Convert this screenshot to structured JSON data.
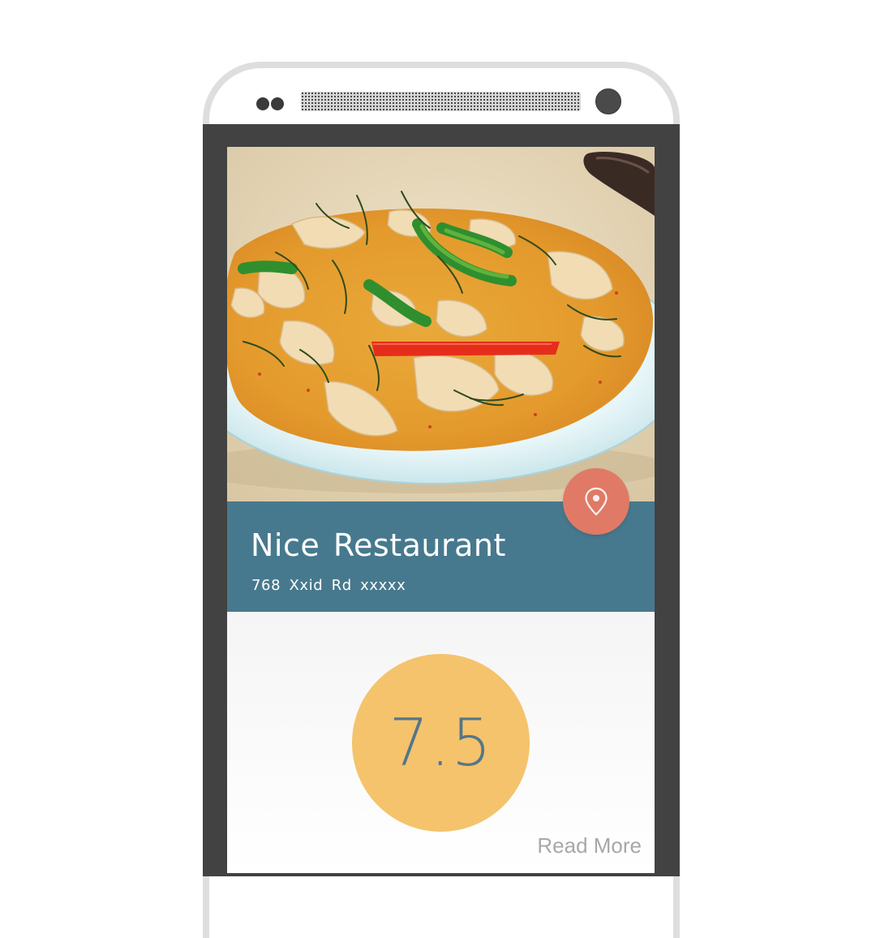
{
  "restaurant": {
    "name": "Nice Restaurant",
    "address": "768 Xxid Rd xxxxx"
  },
  "rating": {
    "score": "7.5"
  },
  "actions": {
    "read_more_label": "Read More"
  },
  "colors": {
    "banner": "#47798e",
    "fab": "#e07a66",
    "score_circle": "#f4c36c",
    "score_text": "#54768a",
    "bezel": "#424242"
  },
  "icons": {
    "location_fab": "map-pin-icon"
  }
}
